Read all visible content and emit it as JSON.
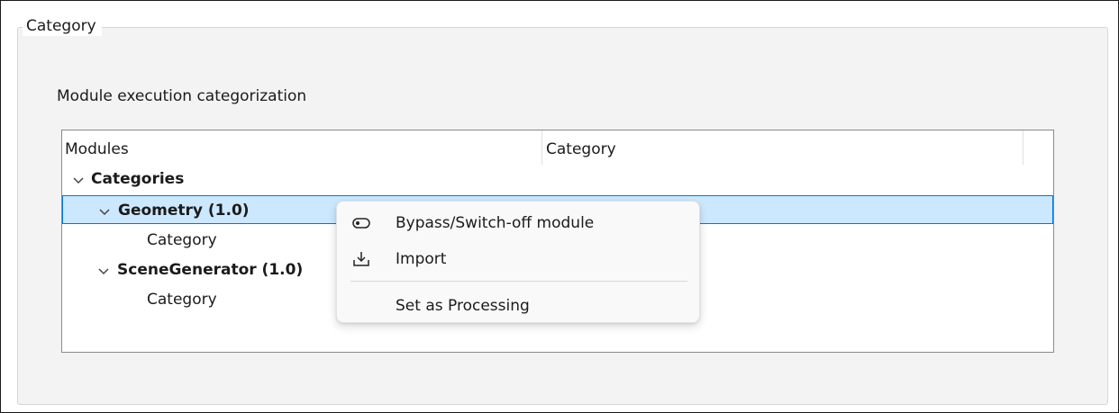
{
  "groupbox": {
    "title": "Category",
    "description": "Module execution categorization"
  },
  "tree": {
    "columns": [
      "Modules",
      "Category"
    ],
    "rows": [
      {
        "label": "Categories",
        "expanded": true,
        "bold": true
      },
      {
        "label": "Geometry (1.0)",
        "expanded": true,
        "bold": true,
        "selected": true
      },
      {
        "label": "Category",
        "bold": false
      },
      {
        "label": "SceneGenerator (1.0)",
        "expanded": true,
        "bold": true
      },
      {
        "label": "Category",
        "bold": false
      }
    ]
  },
  "context_menu": {
    "items": [
      {
        "label": "Bypass/Switch-off module",
        "icon": "toggle-off-icon"
      },
      {
        "label": "Import",
        "icon": "import-icon"
      },
      {
        "label": "Set as Processing",
        "icon": ""
      }
    ]
  },
  "colors": {
    "selection_fill": "#cce8ff",
    "selection_border": "#0078d7",
    "group_background": "#f3f3f3"
  }
}
